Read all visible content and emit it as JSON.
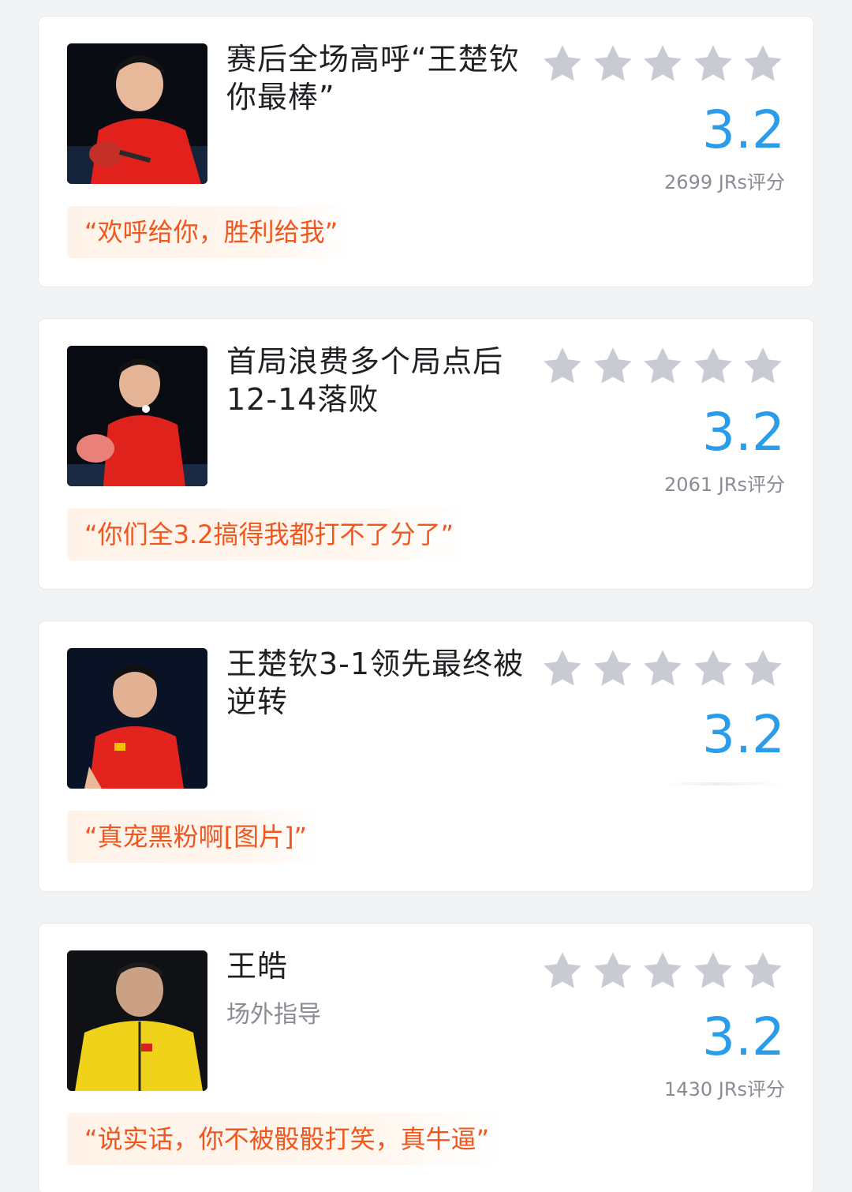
{
  "colors": {
    "score": "#2b9cea",
    "quote_text": "#f0571e",
    "quote_bg": "#fff3e9",
    "star_empty": "#c9cbd3"
  },
  "cards": [
    {
      "title": "赛后全场高呼“王楚钦你最棒”",
      "subtitle": "",
      "rating": 3.2,
      "score": "3.2",
      "stars_filled": 0,
      "count": "2699 JRs评分",
      "quote": "“欢呼给你，胜利给我”"
    },
    {
      "title": "首局浪费多个局点后12-14落败",
      "subtitle": "",
      "rating": 3.2,
      "score": "3.2",
      "stars_filled": 0,
      "count": "2061 JRs评分",
      "quote": "“你们全3.2搞得我都打不了分了”"
    },
    {
      "title": "王楚钦3-1领先最终被逆转",
      "subtitle": "",
      "rating": 3.2,
      "score": "3.2",
      "stars_filled": 0,
      "count": "",
      "quote": "“真宠黑粉啊[图片]”"
    },
    {
      "title": "王皓",
      "subtitle": "场外指导",
      "rating": 3.2,
      "score": "3.2",
      "stars_filled": 0,
      "count": "1430 JRs评分",
      "quote": "“说实话，你不被骰骰打笑，真牛逼”"
    }
  ]
}
